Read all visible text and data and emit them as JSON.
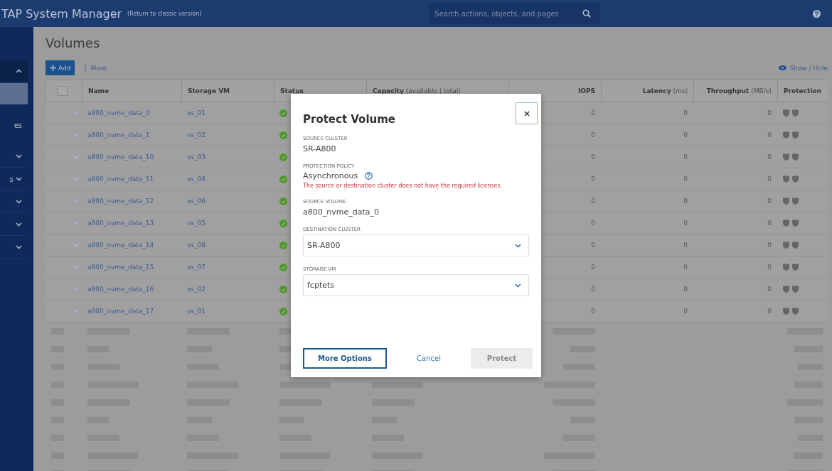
{
  "header": {
    "title": "TAP System Manager",
    "classic_link": "(Return to classic version)",
    "search": {
      "placeholder": "Search actions, objects, and pages"
    }
  },
  "sidebar": {
    "items": [
      {
        "kind": "toggle",
        "expanded": true,
        "selected": false
      },
      {
        "kind": "plain",
        "selected": true
      },
      {
        "label": "es",
        "kind": "plain",
        "selected": false
      },
      {
        "kind": "toggle",
        "expanded": false,
        "selected": false
      },
      {
        "label": "s",
        "kind": "toggle",
        "expanded": false,
        "selected": false
      },
      {
        "kind": "toggle",
        "expanded": false,
        "selected": false
      },
      {
        "kind": "toggle",
        "expanded": false,
        "selected": false
      },
      {
        "kind": "toggle",
        "expanded": false,
        "selected": false
      }
    ]
  },
  "page": {
    "title": "Volumes",
    "add_button": "Add",
    "more_button": "More",
    "show_hide": "Show / Hide"
  },
  "table": {
    "select_all": {
      "checked": false
    },
    "columns": [
      {
        "label": "Name"
      },
      {
        "label": "Storage VM"
      },
      {
        "label": "Status"
      },
      {
        "label": "Capacity",
        "unit": "(available | total)"
      },
      {
        "label": "IOPS"
      },
      {
        "label": "Latency",
        "unit": "(ms)"
      },
      {
        "label": "Throughput",
        "unit": "(MB/s)"
      },
      {
        "label": "Protection"
      }
    ],
    "rows": [
      {
        "name": "a800_nvme_data_0",
        "storage_vm": "vs_01",
        "iops": "0",
        "latency": "0",
        "throughput": "0"
      },
      {
        "name": "a800_nvme_data_1",
        "storage_vm": "vs_02",
        "iops": "0",
        "latency": "0",
        "throughput": "0"
      },
      {
        "name": "a800_nvme_data_10",
        "storage_vm": "vs_03",
        "iops": "0",
        "latency": "0",
        "throughput": "0"
      },
      {
        "name": "a800_nvme_data_11",
        "storage_vm": "vs_04",
        "iops": "0",
        "latency": "0",
        "throughput": "0"
      },
      {
        "name": "a800_nvme_data_12",
        "storage_vm": "vs_06",
        "iops": "0",
        "latency": "0",
        "throughput": "0"
      },
      {
        "name": "a800_nvme_data_13",
        "storage_vm": "vs_05",
        "iops": "0",
        "latency": "0",
        "throughput": "0"
      },
      {
        "name": "a800_nvme_data_14",
        "storage_vm": "vs_08",
        "iops": "0",
        "latency": "0",
        "throughput": "0"
      },
      {
        "name": "a800_nvme_data_15",
        "storage_vm": "vs_07",
        "iops": "0",
        "latency": "0",
        "throughput": "0"
      },
      {
        "name": "a800_nvme_data_16",
        "storage_vm": "vs_02",
        "iops": "0",
        "latency": "0",
        "throughput": "0"
      },
      {
        "name": "a800_nvme_data_17",
        "storage_vm": "vs_01",
        "iops": "0",
        "latency": "0",
        "throughput": "0"
      }
    ]
  },
  "dialog": {
    "title": "Protect Volume",
    "source_cluster": {
      "label": "SOURCE CLUSTER",
      "value": "SR-A800"
    },
    "protection_policy": {
      "label": "PROTECTION POLICY",
      "value": "Asynchronous",
      "error": "The source or destination cluster does not have the required licenses."
    },
    "source_volume": {
      "label": "SOURCE VOLUME",
      "value": "a800_nvme_data_0"
    },
    "destination_cluster": {
      "label": "DESTINATION CLUSTER",
      "value": "SR-A800"
    },
    "storage_vm": {
      "label": "STORAGE VM",
      "value": "fcptets"
    },
    "buttons": [
      {
        "label": "More Options",
        "kind": "outline",
        "disabled": false
      },
      {
        "label": "Cancel",
        "kind": "text",
        "disabled": false
      },
      {
        "label": "Protect",
        "kind": "primary",
        "disabled": true
      }
    ]
  }
}
